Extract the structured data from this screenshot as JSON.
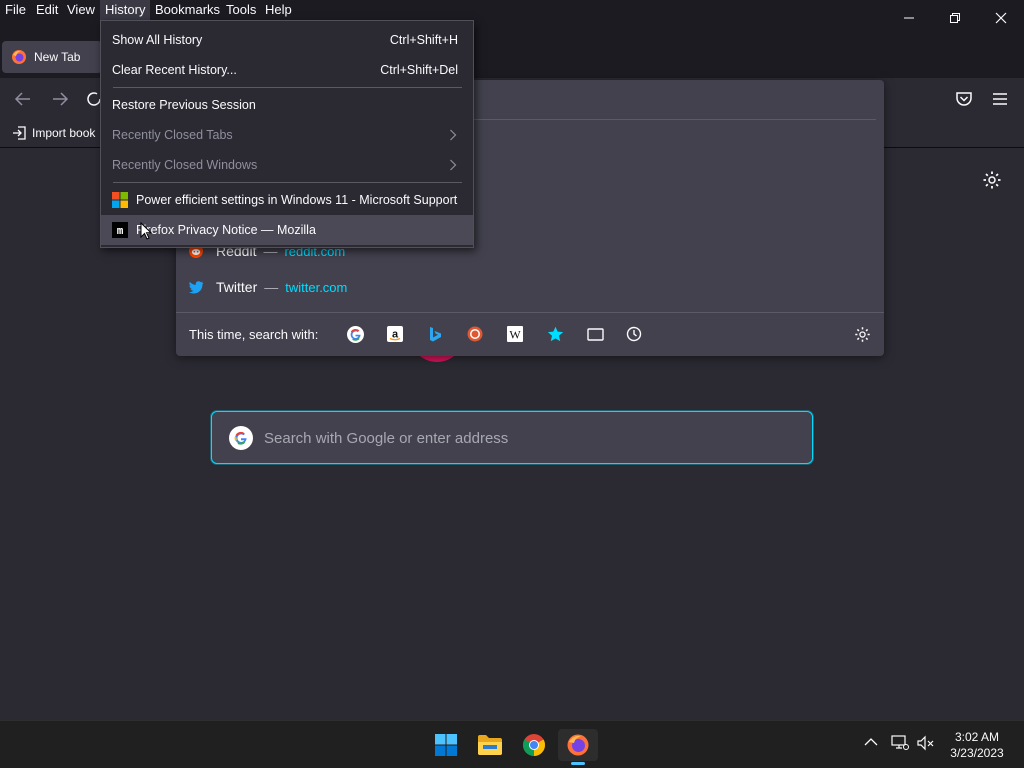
{
  "menubar": {
    "items": [
      "File",
      "Edit",
      "View",
      "History",
      "Bookmarks",
      "Tools",
      "Help"
    ]
  },
  "tab": {
    "label": "New Tab"
  },
  "bookmarks_toolbar": {
    "import_label": "Import book"
  },
  "history_menu": {
    "show_all": {
      "label": "Show All History",
      "shortcut": "Ctrl+Shift+H"
    },
    "clear_recent": {
      "label": "Clear Recent History...",
      "shortcut": "Ctrl+Shift+Del"
    },
    "restore_session": "Restore Previous Session",
    "recently_closed_tabs": "Recently Closed Tabs",
    "recently_closed_windows": "Recently Closed Windows",
    "recent_pages": [
      {
        "title": "Power efficient settings in Windows 11 - Microsoft Support",
        "icon": "microsoft-icon"
      },
      {
        "title": "Firefox Privacy Notice — Mozilla",
        "icon": "mozilla-icon"
      }
    ]
  },
  "url_dropdown": {
    "sites": [
      {
        "name": "Reddit",
        "sep": "—",
        "url": "reddit.com",
        "icon": "reddit-icon"
      },
      {
        "name": "Twitter",
        "sep": "—",
        "url": "twitter.com",
        "icon": "twitter-icon"
      }
    ],
    "search_with_label": "This time, search with:",
    "engines": [
      "google-icon",
      "amazon-icon",
      "bing-icon",
      "duckduckgo-icon",
      "wikipedia-icon",
      "bookmarks-star-icon",
      "tabs-icon",
      "history-icon"
    ]
  },
  "search": {
    "placeholder": "Search with Google or enter address"
  },
  "clock": {
    "time": "3:02 AM",
    "date": "3/23/2023"
  },
  "colors": {
    "accent": "#00ddff",
    "bg": "#1c1b22",
    "panel": "#42414d"
  }
}
